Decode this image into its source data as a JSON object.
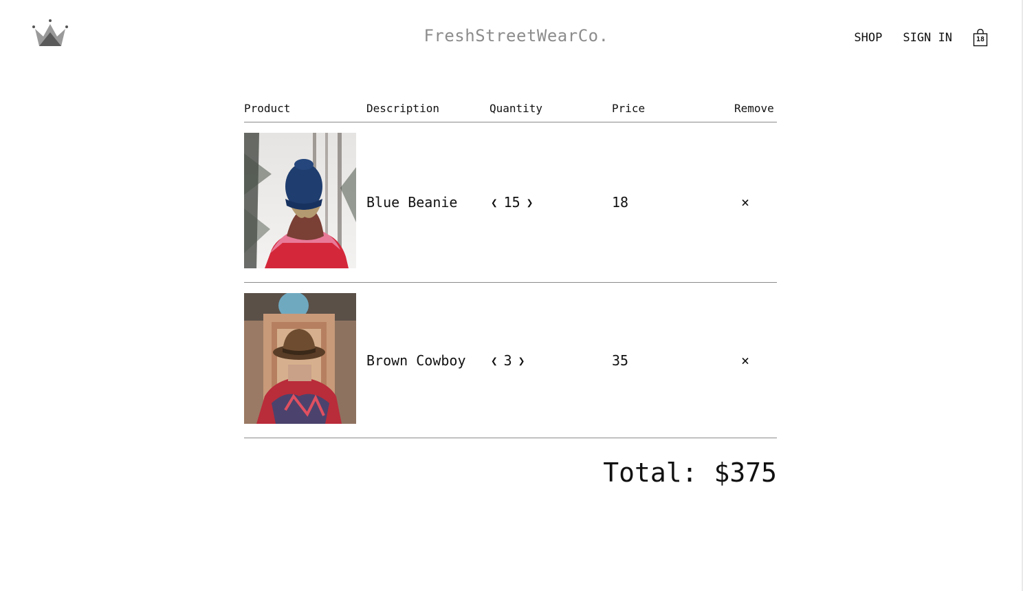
{
  "header": {
    "logo_icon": "crown-icon",
    "brand": "FreshStreetWearCo.",
    "nav": {
      "shop": "SHOP",
      "sign_in": "SIGN IN"
    },
    "cart": {
      "icon": "shopping-bag-icon",
      "count": "18"
    }
  },
  "table": {
    "headers": {
      "product": "Product",
      "description": "Description",
      "quantity": "Quantity",
      "price": "Price",
      "remove": "Remove"
    },
    "rows": [
      {
        "image": "blue-beanie-photo",
        "description": "Blue Beanie",
        "quantity": "15",
        "price": "18",
        "remove": "×",
        "decrement": "❮",
        "increment": "❯"
      },
      {
        "image": "brown-cowboy-photo",
        "description": "Brown Cowboy",
        "quantity": "3",
        "price": "35",
        "remove": "×",
        "decrement": "❮",
        "increment": "❯"
      }
    ]
  },
  "total": {
    "label": "Total:",
    "amount": "$375"
  },
  "colors": {
    "brand_text": "#8c8c8c",
    "text": "#111111",
    "divider": "#8a8a8a"
  }
}
